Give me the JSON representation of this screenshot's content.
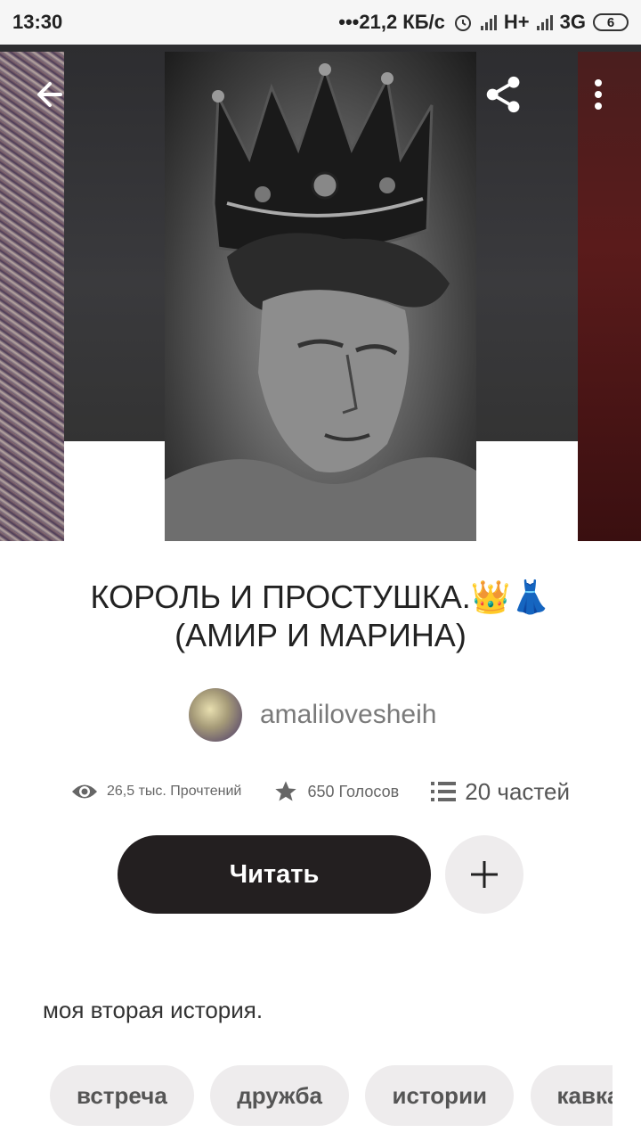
{
  "status_bar": {
    "time": "13:30",
    "network_speed": "•••21,2 КБ/с",
    "network_1": "H+",
    "network_2": "3G",
    "battery": "6"
  },
  "toolbar": {
    "back_icon": "arrow-left-icon",
    "share_icon": "share-icon",
    "more_icon": "more-vertical-icon"
  },
  "story": {
    "title_line1": "КОРОЛЬ И ПРОСТУШКА.👑👗",
    "title_line2": "(АМИР И МАРИНА)",
    "author": "amalilovesheih",
    "reads": "26,5 тыс. Прочтений",
    "votes": "650 Голосов",
    "parts": "20 частей",
    "description": "моя вторая история."
  },
  "actions": {
    "read_label": "Читать",
    "add_icon": "plus-icon"
  },
  "tags": [
    "встреча",
    "дружба",
    "истории",
    "кавказ"
  ],
  "colors": {
    "primary_button": "#231f20",
    "secondary_button": "#eeeced"
  }
}
